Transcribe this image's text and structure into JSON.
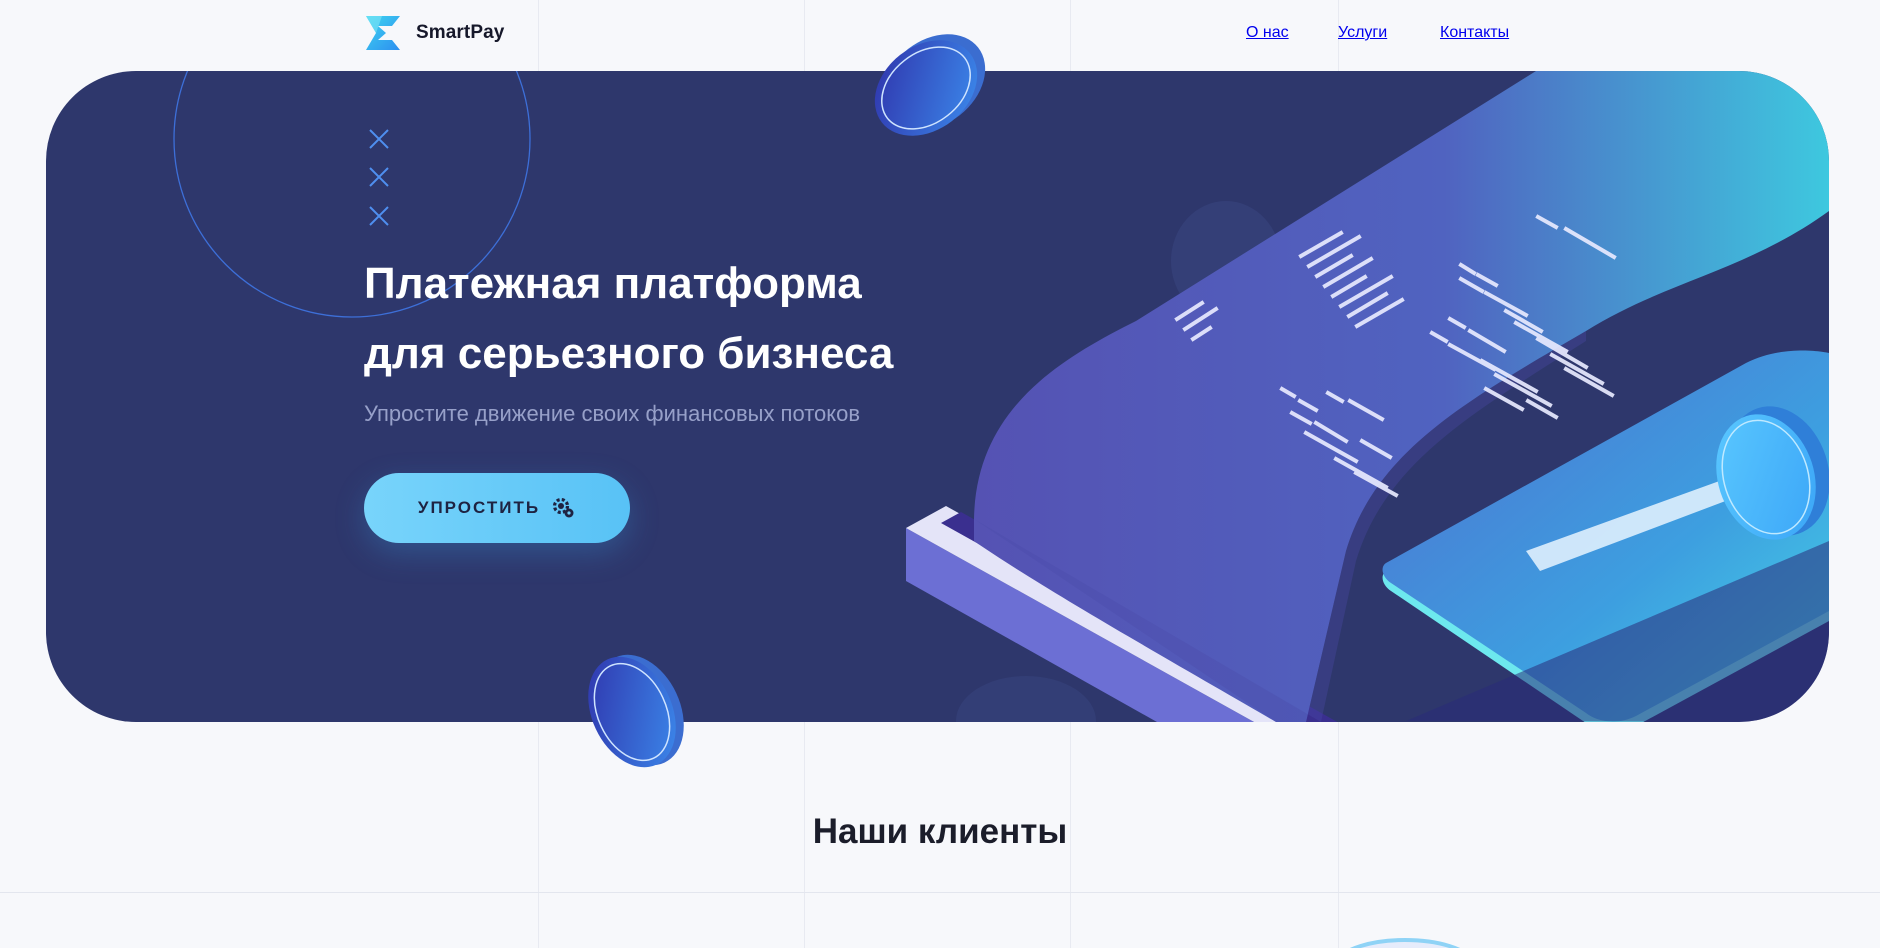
{
  "header": {
    "brand": "SmartPay",
    "nav": [
      {
        "label": "О нас"
      },
      {
        "label": "Услуги"
      },
      {
        "label": "Контакты"
      }
    ]
  },
  "hero": {
    "title_line1": "Платежная платформа",
    "title_line2": "для серьезного бизнеса",
    "subtitle": "Упростите движение своих финансовых потоков",
    "cta_label": "УПРОСТИТЬ"
  },
  "clients": {
    "title": "Наши клиенты"
  },
  "colors": {
    "hero_bg": "#2e376c",
    "accent": "#58c2f6",
    "page_bg": "#f7f8fb",
    "text_dark": "#1b1d2a"
  },
  "icons": {
    "logo": "smartpay-logo-icon",
    "cta": "gear-icon"
  }
}
